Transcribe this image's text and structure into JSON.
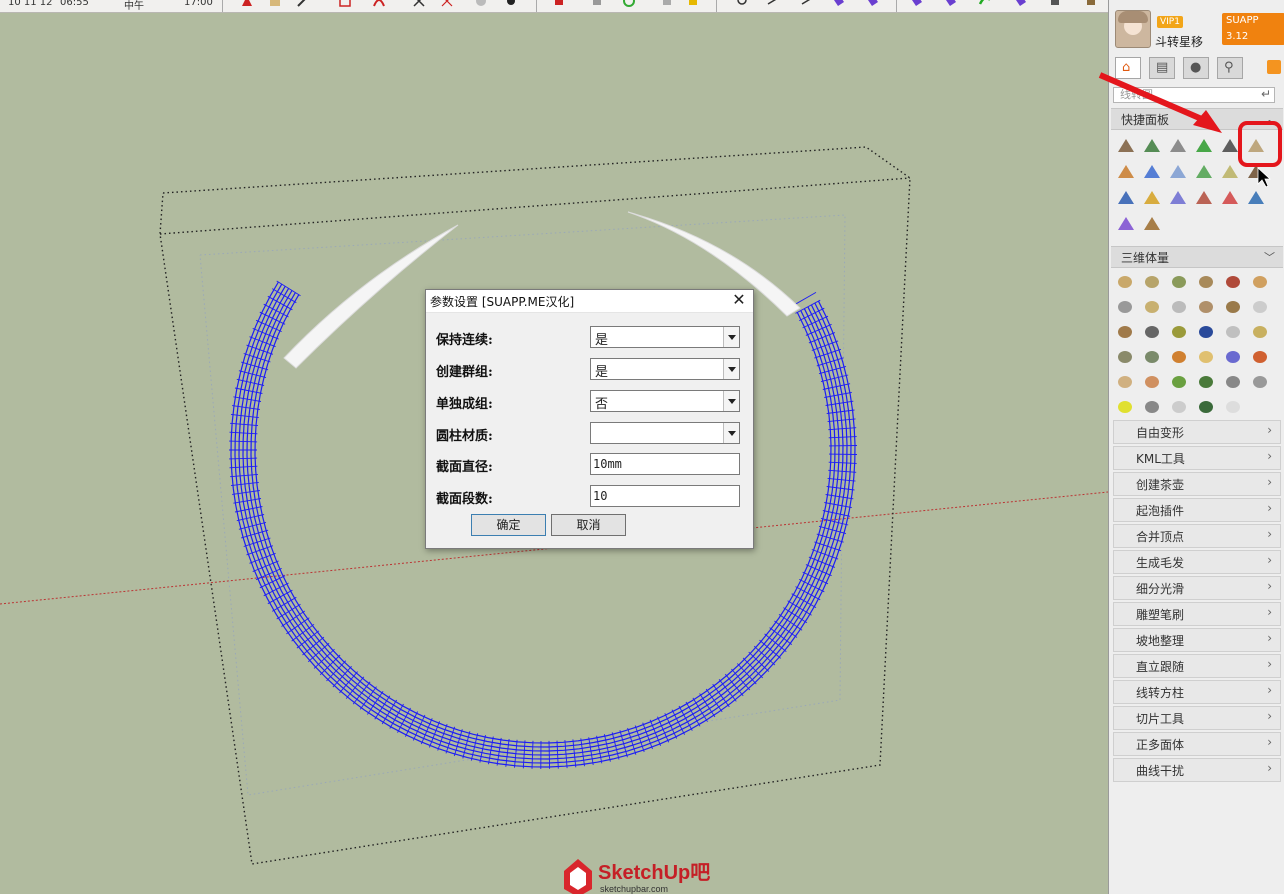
{
  "toolbar": {
    "date_text": "10 11 12",
    "time_text": "06:55",
    "ampm_text": "中午",
    "time2_text": "17:00"
  },
  "dialog": {
    "title": "参数设置 [SUAPP.ME汉化]",
    "fields": [
      {
        "label": "保持连续:",
        "type": "select",
        "value": "是"
      },
      {
        "label": "创建群组:",
        "type": "select",
        "value": "是"
      },
      {
        "label": "单独成组:",
        "type": "select",
        "value": "否"
      },
      {
        "label": "圆柱材质:",
        "type": "select",
        "value": ""
      },
      {
        "label": "截面直径:",
        "type": "input",
        "value": "10mm"
      },
      {
        "label": "截面段数:",
        "type": "input",
        "value": "10"
      }
    ],
    "ok_label": "确定",
    "cancel_label": "取消"
  },
  "panel": {
    "vip_label": "VIP1",
    "version_label": "SUAPP 3.12",
    "username": "斗转星移",
    "tabs": [
      "home-icon",
      "keyboard-icon",
      "user-icon",
      "search-icon"
    ],
    "search_value": "线转圆",
    "quick_panel_title": "快捷面板",
    "volume_title": "三维体量",
    "menu_items": [
      "自由变形",
      "KML工具",
      "创建茶壶",
      "起泡插件",
      "合并顶点",
      "生成毛发",
      "细分光滑",
      "雕塑笔刷",
      "坡地整理",
      "直立跟随",
      "线转方柱",
      "切片工具",
      "正多面体",
      "曲线干扰"
    ]
  },
  "watermark": {
    "text": "SketchUp吧",
    "url": "sketchupbar.com"
  },
  "colors": {
    "viewport_bg": "#b1bb9f",
    "wire_blue": "#1d1df5",
    "annotation_red": "#e4161c",
    "vip_orange": "#f2a518"
  }
}
